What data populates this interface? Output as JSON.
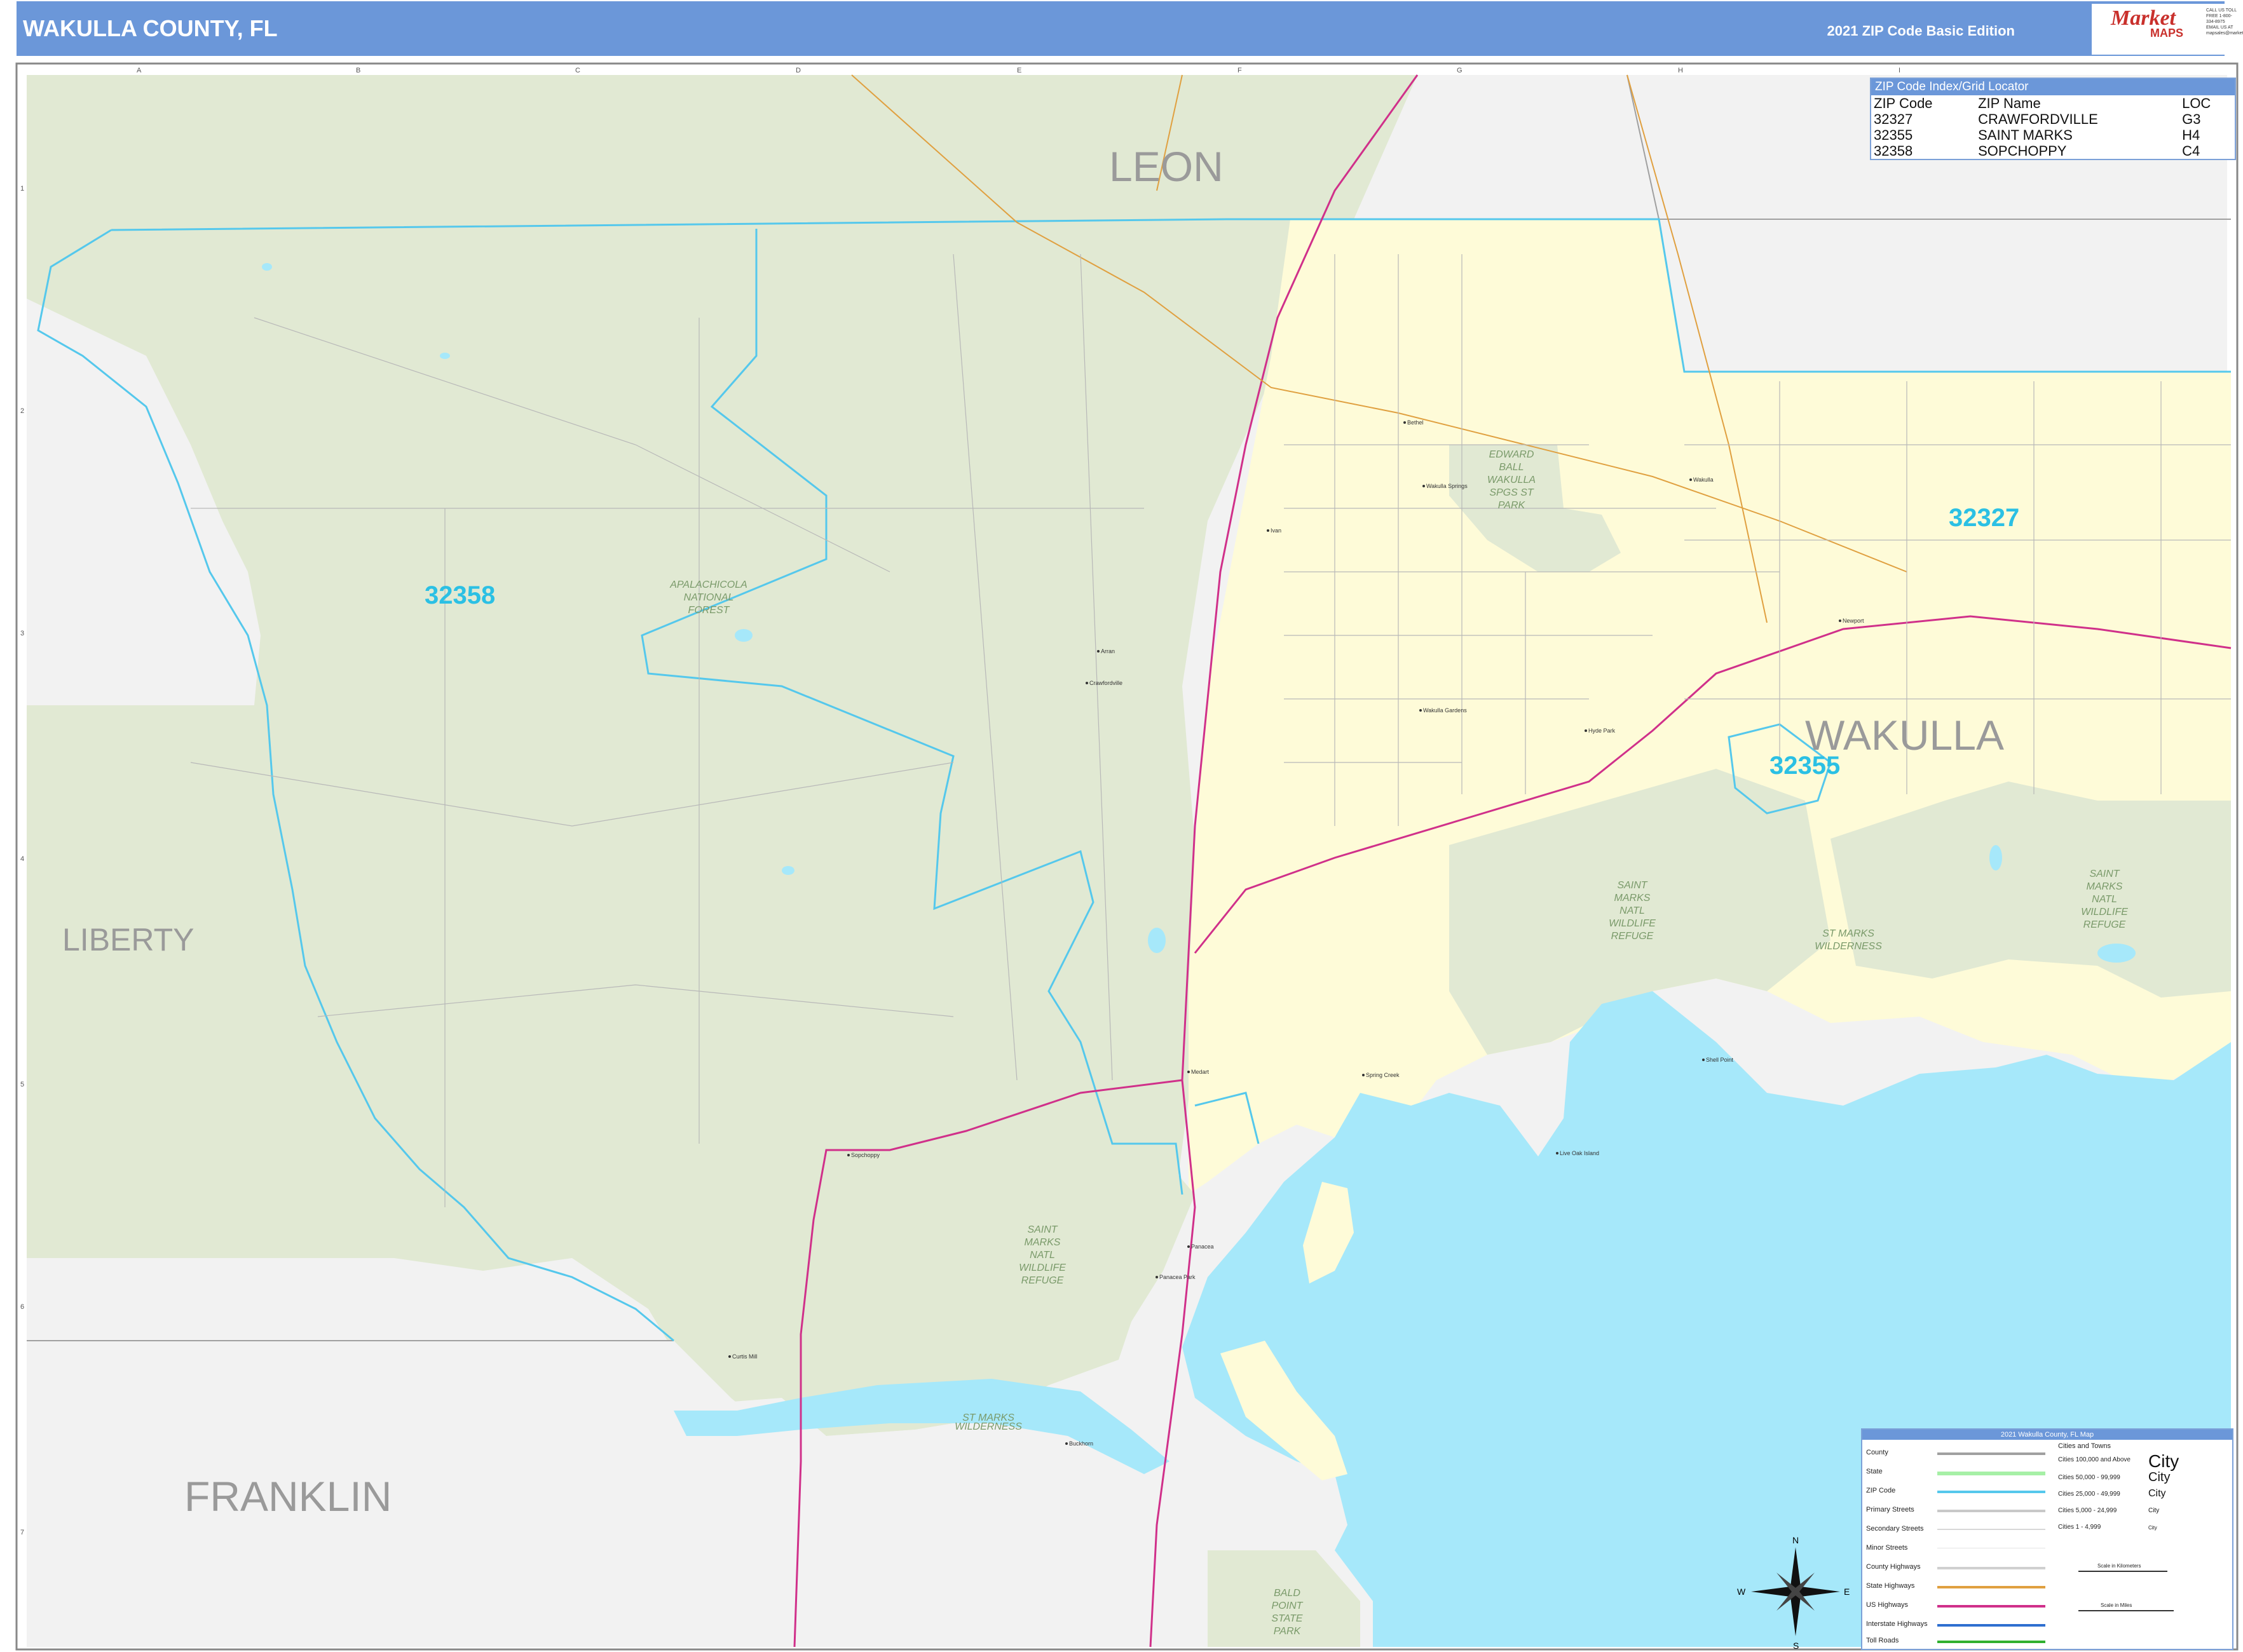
{
  "header": {
    "title": "WAKULLA COUNTY, FL",
    "edition": "2021 ZIP Code Basic Edition",
    "logo_name": "Market",
    "logo_maps": "MAPS",
    "logo_contact": "CALL US TOLL FREE 1-800-334-8975 EMAIL US AT mapsales@marketmaps.com"
  },
  "counties": {
    "leon": "LEON",
    "liberty": "LIBERTY",
    "franklin": "FRANKLIN",
    "wakulla": "WAKULLA"
  },
  "zips": {
    "z32358": "32358",
    "z32327": "32327",
    "z32355": "32355"
  },
  "areas": {
    "apalachicola": [
      "APALACHICOLA",
      "NATIONAL",
      "FOREST"
    ],
    "edward_ball": [
      "EDWARD",
      "BALL",
      "WAKULLA",
      "SPGS ST",
      "PARK"
    ],
    "smnwr_center": [
      "SAINT",
      "MARKS",
      "NATL",
      "WILDLIFE",
      "REFUGE"
    ],
    "smnwr_east": [
      "SAINT",
      "MARKS",
      "NATL",
      "WILDLIFE",
      "REFUGE"
    ],
    "smnwr_west": [
      "SAINT",
      "MARKS",
      "NATL",
      "WILDLIFE",
      "REFUGE"
    ],
    "sm_wilderness_east": [
      "ST MARKS",
      "WILDERNESS"
    ],
    "sm_wilderness_west": [
      "ST MARKS",
      "WILDERNESS"
    ],
    "bald_point": [
      "BALD",
      "POINT",
      "STATE",
      "PARK"
    ]
  },
  "places": {
    "bethel": "Bethel",
    "wakulla_springs": "Wakulla Springs",
    "wakulla_town": "Wakulla",
    "crawfordville": "Crawfordville",
    "arran": "Arran",
    "wakulla_gardens": "Wakulla Gardens",
    "hyde_park": "Hyde Park",
    "newport": "Newport",
    "medart": "Medart",
    "spring_creek": "Spring Creek",
    "shell_point": "Shell Point",
    "live_oak_island": "Live Oak Island",
    "sopchoppy": "Sopchoppy",
    "panacea": "Panacea",
    "panacea_park": "Panacea Park",
    "curtis_mill": "Curtis Mill",
    "ivan": "Ivan",
    "buckhorn": "Buckhorn"
  },
  "grid": {
    "cols": [
      "A",
      "B",
      "C",
      "D",
      "E",
      "F",
      "G",
      "H",
      "I"
    ],
    "rows": [
      "1",
      "2",
      "3",
      "4",
      "5",
      "6",
      "7"
    ]
  },
  "zip_index": {
    "title": "ZIP Code Index/Grid Locator",
    "headers": [
      "ZIP Code",
      "ZIP Name",
      "LOC"
    ],
    "rows": [
      [
        "32327",
        "CRAWFORDVILLE",
        "G3"
      ],
      [
        "32355",
        "SAINT MARKS",
        "H4"
      ],
      [
        "32358",
        "SOPCHOPPY",
        "C4"
      ]
    ]
  },
  "legend": {
    "title": "2021 Wakulla County, FL Map",
    "items": [
      "County",
      "State",
      "ZIP Code",
      "Primary Streets",
      "Secondary Streets",
      "Minor Streets",
      "County Highways",
      "State Highways",
      "US Highways",
      "Interstate Highways",
      "Toll Roads"
    ],
    "cities_header": "Cities and Towns",
    "city_classes": [
      "Cities 100,000 and Above",
      "Cities 50,000 - 99,999",
      "Cities 25,000 - 49,999",
      "Cities 5,000 - 24,999",
      "Cities 1 - 4,999"
    ],
    "city_samples": [
      "City",
      "City",
      "City",
      "City",
      "City"
    ],
    "scale_km": "Scale in Kilometers",
    "scale_mi": "Scale in Miles",
    "colors": {
      "county": "#a0a0a0",
      "state": "#a6f0a6",
      "zip": "#55c8ec",
      "county_hwy": "#d0d0d0",
      "state_hwy": "#e0a040",
      "us_hwy": "#d0308a",
      "interstate": "#2e6fd0",
      "toll": "#30b030"
    }
  },
  "compass": {
    "n": "N",
    "s": "S",
    "e": "E",
    "w": "W"
  },
  "colors": {
    "title_bar": "#6b97d9",
    "water": "#a6e8fa",
    "land_green": "#e1e9d3",
    "land_yellow": "#fefbd8",
    "land_gray": "#f2f2f2",
    "zip_boundary": "#55c8ec",
    "us_highway": "#d0308a"
  }
}
